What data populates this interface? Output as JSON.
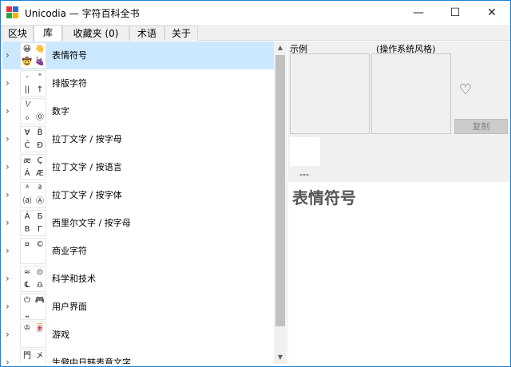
{
  "window": {
    "title": "Unicodia — 字符百科全书",
    "controls": {
      "minimize": "—",
      "maximize": "☐",
      "close": "✕"
    },
    "icon_colors": [
      "#e0343c",
      "#2b6cd0",
      "#2aa04a",
      "#f0b400"
    ]
  },
  "tabs": [
    {
      "label": "区块",
      "active": false
    },
    {
      "label": "库",
      "active": true
    },
    {
      "label": "收藏夹 (0)",
      "active": false
    },
    {
      "label": "术语",
      "active": false
    },
    {
      "label": "关于",
      "active": false
    }
  ],
  "library": {
    "items": [
      {
        "label": "表情符号",
        "selected": true,
        "glyphs": [
          "😀",
          "👋",
          "🤠",
          "🍇"
        ]
      },
      {
        "label": "排版字符",
        "selected": false,
        "glyphs": [
          "-",
          "\"",
          "||",
          "↑"
        ]
      },
      {
        "label": "数字",
        "selected": false,
        "glyphs": [
          "¹⁄",
          "",
          "₀",
          "⓪"
        ]
      },
      {
        "label": "拉丁文字 / 按字母",
        "selected": false,
        "glyphs": [
          "Ɐ",
          "B̈",
          "Ĉ",
          "Ð"
        ]
      },
      {
        "label": "拉丁文字 / 按语言",
        "selected": false,
        "glyphs": [
          "æ",
          "Ç",
          "Á",
          "Æ"
        ]
      },
      {
        "label": "拉丁文字 / 按字体",
        "selected": false,
        "glyphs": [
          "ᴬ",
          "ª",
          "⒜",
          "Ⓐ"
        ]
      },
      {
        "label": "西里尔文字 / 按字母",
        "selected": false,
        "glyphs": [
          "Á",
          "Б",
          "В",
          "Г"
        ]
      },
      {
        "label": "商业字符",
        "selected": false,
        "glyphs": [
          "¤",
          "©",
          "",
          ""
        ]
      },
      {
        "label": "科学和技术",
        "selected": false,
        "glyphs": [
          "≈",
          "⊙",
          "℄",
          "♎"
        ]
      },
      {
        "label": "用户界面",
        "selected": false,
        "glyphs": [
          "⏻",
          "🎮",
          "⎵",
          ""
        ]
      },
      {
        "label": "游戏",
        "selected": false,
        "glyphs": [
          "♔",
          "🀄",
          "",
          ""
        ]
      },
      {
        "label": "生僻中日韩表意文字",
        "selected": false,
        "glyphs": [
          "門",
          "㐅",
          "⺈",
          "⺀"
        ]
      }
    ],
    "expand_icon": "›"
  },
  "scrollbar": {
    "up": "▲",
    "down": "▼"
  },
  "details": {
    "sample_caption": "示例",
    "os_caption": "(操作系统风格)",
    "favorite_icon": "♡",
    "copy_label": "复制",
    "code": "---",
    "title": "表情符号"
  }
}
